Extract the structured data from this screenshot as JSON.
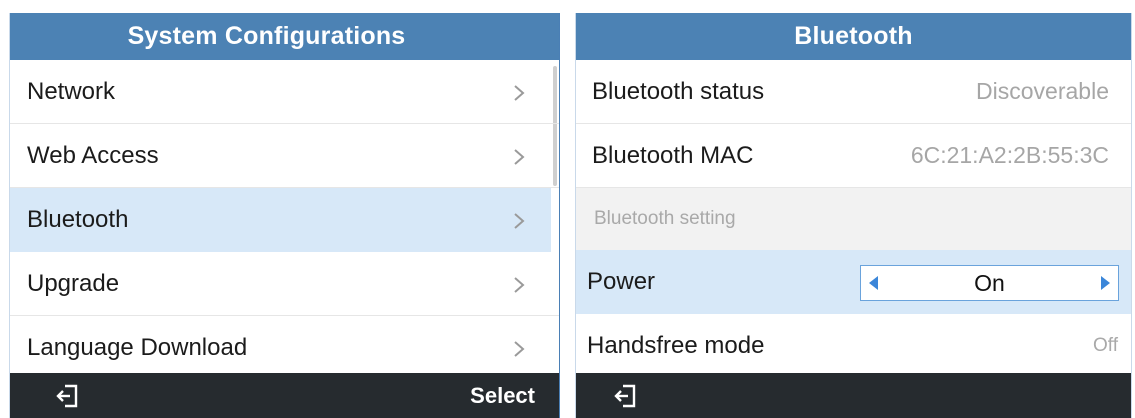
{
  "left_screen": {
    "title": "System Configurations",
    "items": [
      {
        "label": "Network"
      },
      {
        "label": "Web Access"
      },
      {
        "label": "Bluetooth"
      },
      {
        "label": "Upgrade"
      },
      {
        "label": "Language Download"
      }
    ],
    "selected_item": "Bluetooth",
    "softkeys": {
      "back_icon": "exit-icon",
      "select_label": "Select"
    }
  },
  "right_screen": {
    "title": "Bluetooth",
    "status_label": "Bluetooth status",
    "status_value": "Discoverable",
    "mac_label": "Bluetooth MAC",
    "mac_value": "6C:21:A2:2B:55:3C",
    "section_label": "Bluetooth setting",
    "power_label": "Power",
    "power_value": "On",
    "handsfree_label": "Handsfree mode",
    "handsfree_value": "Off",
    "softkeys": {
      "back_icon": "exit-icon"
    }
  },
  "colors": {
    "title_bar": "#4c82b4",
    "selection": "#d7e8f8",
    "softkey_bar": "#262b2f",
    "arrow_accent": "#3b86d9"
  }
}
